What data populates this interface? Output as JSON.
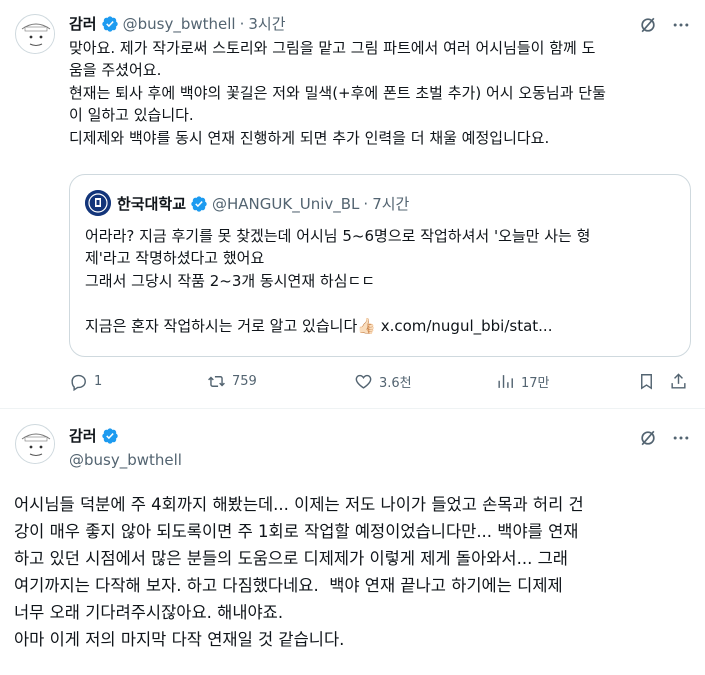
{
  "tweet1": {
    "author_name": "감러",
    "author_handle": "@busy_bwthell",
    "separator": "·",
    "time": "3시간",
    "text": "맞아요. 제가 작가로써 스토리와 그림을 맡고 그림 파트에서 여러 어시님들이 함께 도\n움을 주셨어요.\n현재는 퇴사 후에 백야의 꽃길은 저와 밀색(+후에 폰트 초벌 추가) 어시 오동님과 단둘\n이 일하고 있습니다.\n디제제와 백야를 동시 연재 진행하게 되면 추가 인력을 더 채울 예정입니다요.",
    "quote": {
      "author_name": "한국대학교",
      "author_handle": "@HANGUK_Univ_BL",
      "separator": "·",
      "time": "7시간",
      "text": "어라라? 지금 후기를 못 찾겠는데 어시님 5~6명으로 작업하셔서 '오늘만 사는 형\n제'라고 작명하셨다고 했어요\n그래서 그당시 작품 2~3개 동시연재 하심ㄷㄷ\n\n지금은 혼자 작업하시는 거로 알고 있습니다👍🏻 ",
      "link_text": "x.com/nugul_bbi/stat..."
    },
    "actions": {
      "replies": "1",
      "reposts": "759",
      "likes": "3.6천",
      "views": "17만"
    }
  },
  "tweet2": {
    "author_name": "감러",
    "author_handle": "@busy_bwthell",
    "text": "어시님들 덕분에 주 4회까지 해봤는데... 이제는 저도 나이가 들었고 손목과 허리 건\n강이 매우 좋지 않아 되도록이면 주 1회로 작업할 예정이었습니다만... 백야를 연재\n하고 있던 시점에서 많은 분들의 도움으로 디제제가 이렇게 제게 돌아와서... 그래\n여기까지는 다작해 보자. 하고 다짐했다네요.  백야 연재 끝나고 하기에는 디제제\n너무 오래 기다려주시잖아요. 해내야죠.\n아마 이게 저의 마지막 다작 연재일 것 같습니다."
  },
  "colors": {
    "text": "#0f1419",
    "muted": "#536471",
    "verified": "#1d9bf0",
    "border": "#cfd9de",
    "quote_avatar": "#13357a"
  },
  "icons": [
    "verified-badge-icon",
    "grok-icon",
    "more-icon",
    "reply-icon",
    "repost-icon",
    "like-icon",
    "views-icon",
    "bookmark-icon",
    "share-icon"
  ]
}
